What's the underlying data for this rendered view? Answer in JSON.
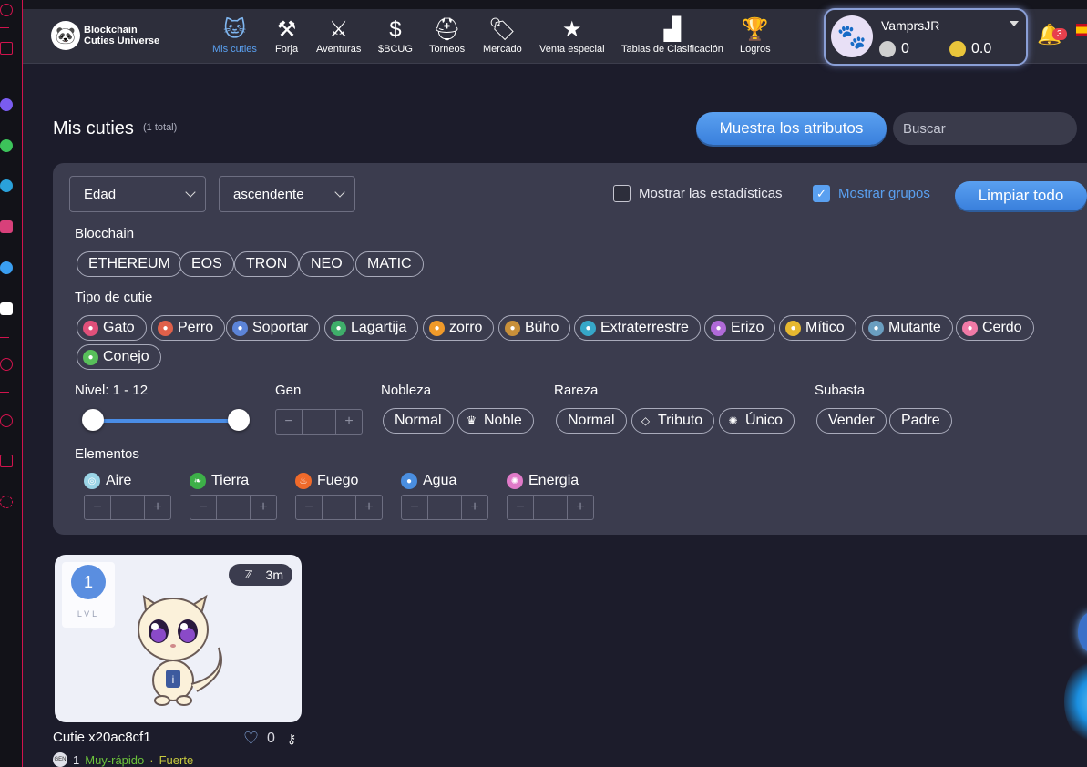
{
  "rail": {
    "icons": [
      "spinner-icon",
      "gift-icon",
      "messenger-icon",
      "whatsapp-icon",
      "telegram-icon",
      "instagram-icon",
      "twitter-icon",
      "discord-icon",
      "youtube-icon",
      "clock-icon",
      "cube-icon",
      "gear-icon"
    ]
  },
  "nav": {
    "logo_line1": "Blockchain",
    "logo_line2": "Cuties Universe",
    "items": [
      {
        "label": "Mis cuties",
        "icon": "cat-face-icon",
        "active": true
      },
      {
        "label": "Forja",
        "icon": "anvil-icon"
      },
      {
        "label": "Aventuras",
        "icon": "crossed-swords-icon"
      },
      {
        "label": "$BCUG",
        "icon": "dollar-chart-icon"
      },
      {
        "label": "Torneos",
        "icon": "helmet-icon"
      },
      {
        "label": "Mercado",
        "icon": "tag-icon"
      },
      {
        "label": "Venta especial",
        "icon": "star-icon"
      },
      {
        "label": "Tablas de Clasificación",
        "icon": "podium-icon"
      },
      {
        "label": "Logros",
        "icon": "trophy-icon"
      }
    ]
  },
  "user": {
    "name": "VamprsJR",
    "silver_balance": "0",
    "gold_balance": "0.0",
    "notifications": "3"
  },
  "page": {
    "title": "Mis cuties",
    "count": "(1 total)",
    "attributes_button": "Muestra los atributos",
    "search_placeholder": "Buscar"
  },
  "filters": {
    "sort_by": "Edad",
    "order": "ascendente",
    "show_stats": "Mostrar las estadísticas",
    "show_groups": "Mostrar grupos",
    "show_groups_checked": true,
    "clear_all": "Limpiar todo",
    "blockchain_label": "Blocchain",
    "blockchains": [
      "ETHEREUM",
      "EOS",
      "TRON",
      "NEO",
      "MATIC"
    ],
    "type_label": "Tipo de cutie",
    "types": [
      {
        "label": "Gato",
        "color": "#e0507a"
      },
      {
        "label": "Perro",
        "color": "#e0604a"
      },
      {
        "label": "Soportar",
        "color": "#5c84d8"
      },
      {
        "label": "Lagartija",
        "color": "#3fae6a"
      },
      {
        "label": "zorro",
        "color": "#f09a2a"
      },
      {
        "label": "Búho",
        "color": "#c8903a"
      },
      {
        "label": "Extraterrestre",
        "color": "#36a7c8"
      },
      {
        "label": "Erizo",
        "color": "#b06ad8"
      },
      {
        "label": "Mítico",
        "color": "#e6b830"
      },
      {
        "label": "Mutante",
        "color": "#6a9ec0"
      },
      {
        "label": "Cerdo",
        "color": "#f07aa6"
      },
      {
        "label": "Conejo",
        "color": "#58c05a"
      }
    ],
    "level_label": "Nivel: 1 - 12",
    "gen_label": "Gen",
    "nobility_label": "Nobleza",
    "nobility": [
      "Normal",
      "Noble"
    ],
    "rarity_label": "Rareza",
    "rarity": [
      "Normal",
      "Tributo",
      "Único"
    ],
    "auction_label": "Subasta",
    "auction": [
      "Vender",
      "Padre"
    ],
    "elements_label": "Elementos",
    "elements": [
      {
        "label": "Aire",
        "color": "#9ad4e6"
      },
      {
        "label": "Tierra",
        "color": "#3db048"
      },
      {
        "label": "Fuego",
        "color": "#f06a2a"
      },
      {
        "label": "Agua",
        "color": "#4a8ee0"
      },
      {
        "label": "Energia",
        "color": "#e07ac8"
      }
    ]
  },
  "cutie": {
    "level": "1",
    "level_caption": "LVL",
    "cooldown": "3m",
    "name": "Cutie x20ac8cf1",
    "likes": "0",
    "gen_icon": "GEN",
    "gen": "1",
    "speed": "Muy-rápido",
    "trait": "Fuerte"
  }
}
